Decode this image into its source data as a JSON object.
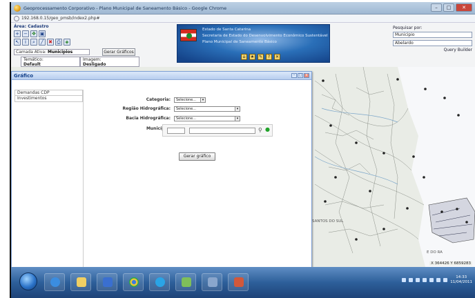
{
  "window": {
    "title": "Geoprocessamento Corporativo - Plano Municipal de Saneamento Básico - Google Chrome",
    "url": "192.168.0.15/geo_pmsb/index2.php#"
  },
  "toolbar": {
    "area_label": "Área: Cadastro",
    "camada_label": "Camada Ativa:",
    "camada_value": "Municipios",
    "gerar_graficos_label": "Gerar Gráficos",
    "tematico_label": "Temático:",
    "tematico_value": "Default",
    "imagem_label": "Imagem:",
    "imagem_value": "Desligado"
  },
  "banner": {
    "line1": "Estado de Santa Catarina",
    "line2": "Secretaria de Estado do Desenvolvimento Econômico Sustentável",
    "line3": "Plano Municipal de Saneamento Básico"
  },
  "search": {
    "label": "Pesquisar por:",
    "field_value": "Municipio",
    "query_value": "Abelardo",
    "query_builder": "Query Builder"
  },
  "dialog": {
    "title": "Gráfico",
    "nav": [
      "Demandas CDP",
      "Investimentos"
    ],
    "categoria_label": "Categoria:",
    "categoria_value": "Selecione...",
    "regiao_label": "Região Hidrográfica:",
    "regiao_value": "Selecione...",
    "bacia_label": "Bacia Hidrográfica:",
    "bacia_value": "Selecione...",
    "municipio_label": "Município:",
    "gerar_button": "Gerar gráfico"
  },
  "map": {
    "coords": "X 364426 Y 6859283",
    "label_lakes": "SANTOS DO SUL",
    "label_coast": "E DO RA"
  },
  "taskbar": {
    "time": "14:33",
    "date": "11/04/2011"
  },
  "colors": {
    "dialog_header": "#b7cdee",
    "accent_blue": "#15428b",
    "taskbar": "#2d5f9a"
  }
}
